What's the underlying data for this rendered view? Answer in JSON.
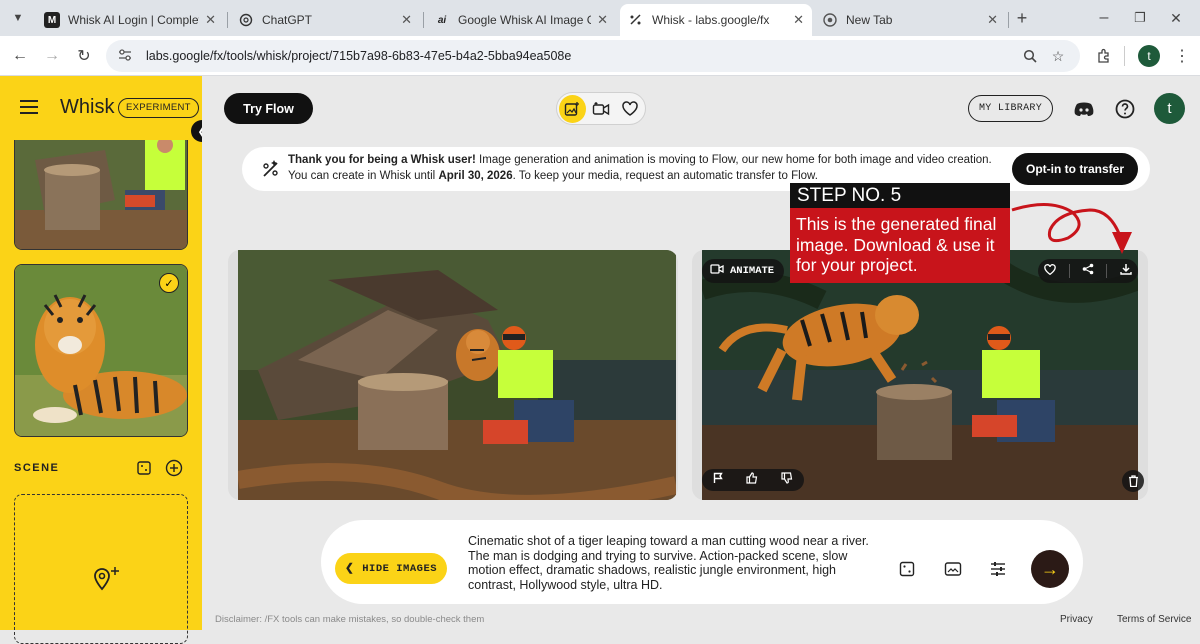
{
  "browser": {
    "tabs": [
      {
        "title": "Whisk AI Login | Complete G",
        "favicon": "M",
        "active": false
      },
      {
        "title": "ChatGPT",
        "favicon": "chatgpt-icon",
        "active": false
      },
      {
        "title": "Google Whisk AI Image Gen",
        "favicon": "ai",
        "active": false
      },
      {
        "title": "Whisk - labs.google/fx",
        "favicon": "whisk-icon",
        "active": true
      },
      {
        "title": "New Tab",
        "favicon": "chrome-icon",
        "active": false
      }
    ],
    "new_tab": "+",
    "url": "labs.google/fx/tools/whisk/project/715b7a98-6b83-47e5-b4a2-5bba94ea508e",
    "profile_initial": "t"
  },
  "sidebar": {
    "logo": "Whisk",
    "badge": "EXPERIMENT",
    "scene_label": "SCENE"
  },
  "header": {
    "try_flow": "Try Flow",
    "my_library": "MY LIBRARY",
    "avatar_initial": "t"
  },
  "banner": {
    "bold_lead": "Thank you for being a Whisk user!",
    "text_a": " Image generation and animation is moving to Flow, our new home for both image and video creation. You can create in Whisk until ",
    "date": "April 30, 2026",
    "text_b": ". To keep your media, request an automatic transfer to Flow.",
    "button": "Opt-in to transfer"
  },
  "result": {
    "animate_label": "ANIMATE"
  },
  "annotation": {
    "heading": "STEP NO. 5",
    "body": "This is the generated final image. Download & use it for your project.",
    "color": "#c8141b"
  },
  "prompt": {
    "hide_images": "HIDE IMAGES",
    "text": "Cinematic shot of a tiger leaping toward a man cutting wood near a river. The man is dodging and trying to survive. Action-packed scene, slow motion effect, dramatic shadows, realistic jungle environment, high contrast, Hollywood style, ultra HD."
  },
  "footer": {
    "disclaimer": "Disclaimer: /FX tools can make mistakes, so double-check them",
    "privacy": "Privacy",
    "terms": "Terms of Service"
  },
  "colors": {
    "brand_yellow": "#fbd317",
    "dark": "#111111"
  }
}
